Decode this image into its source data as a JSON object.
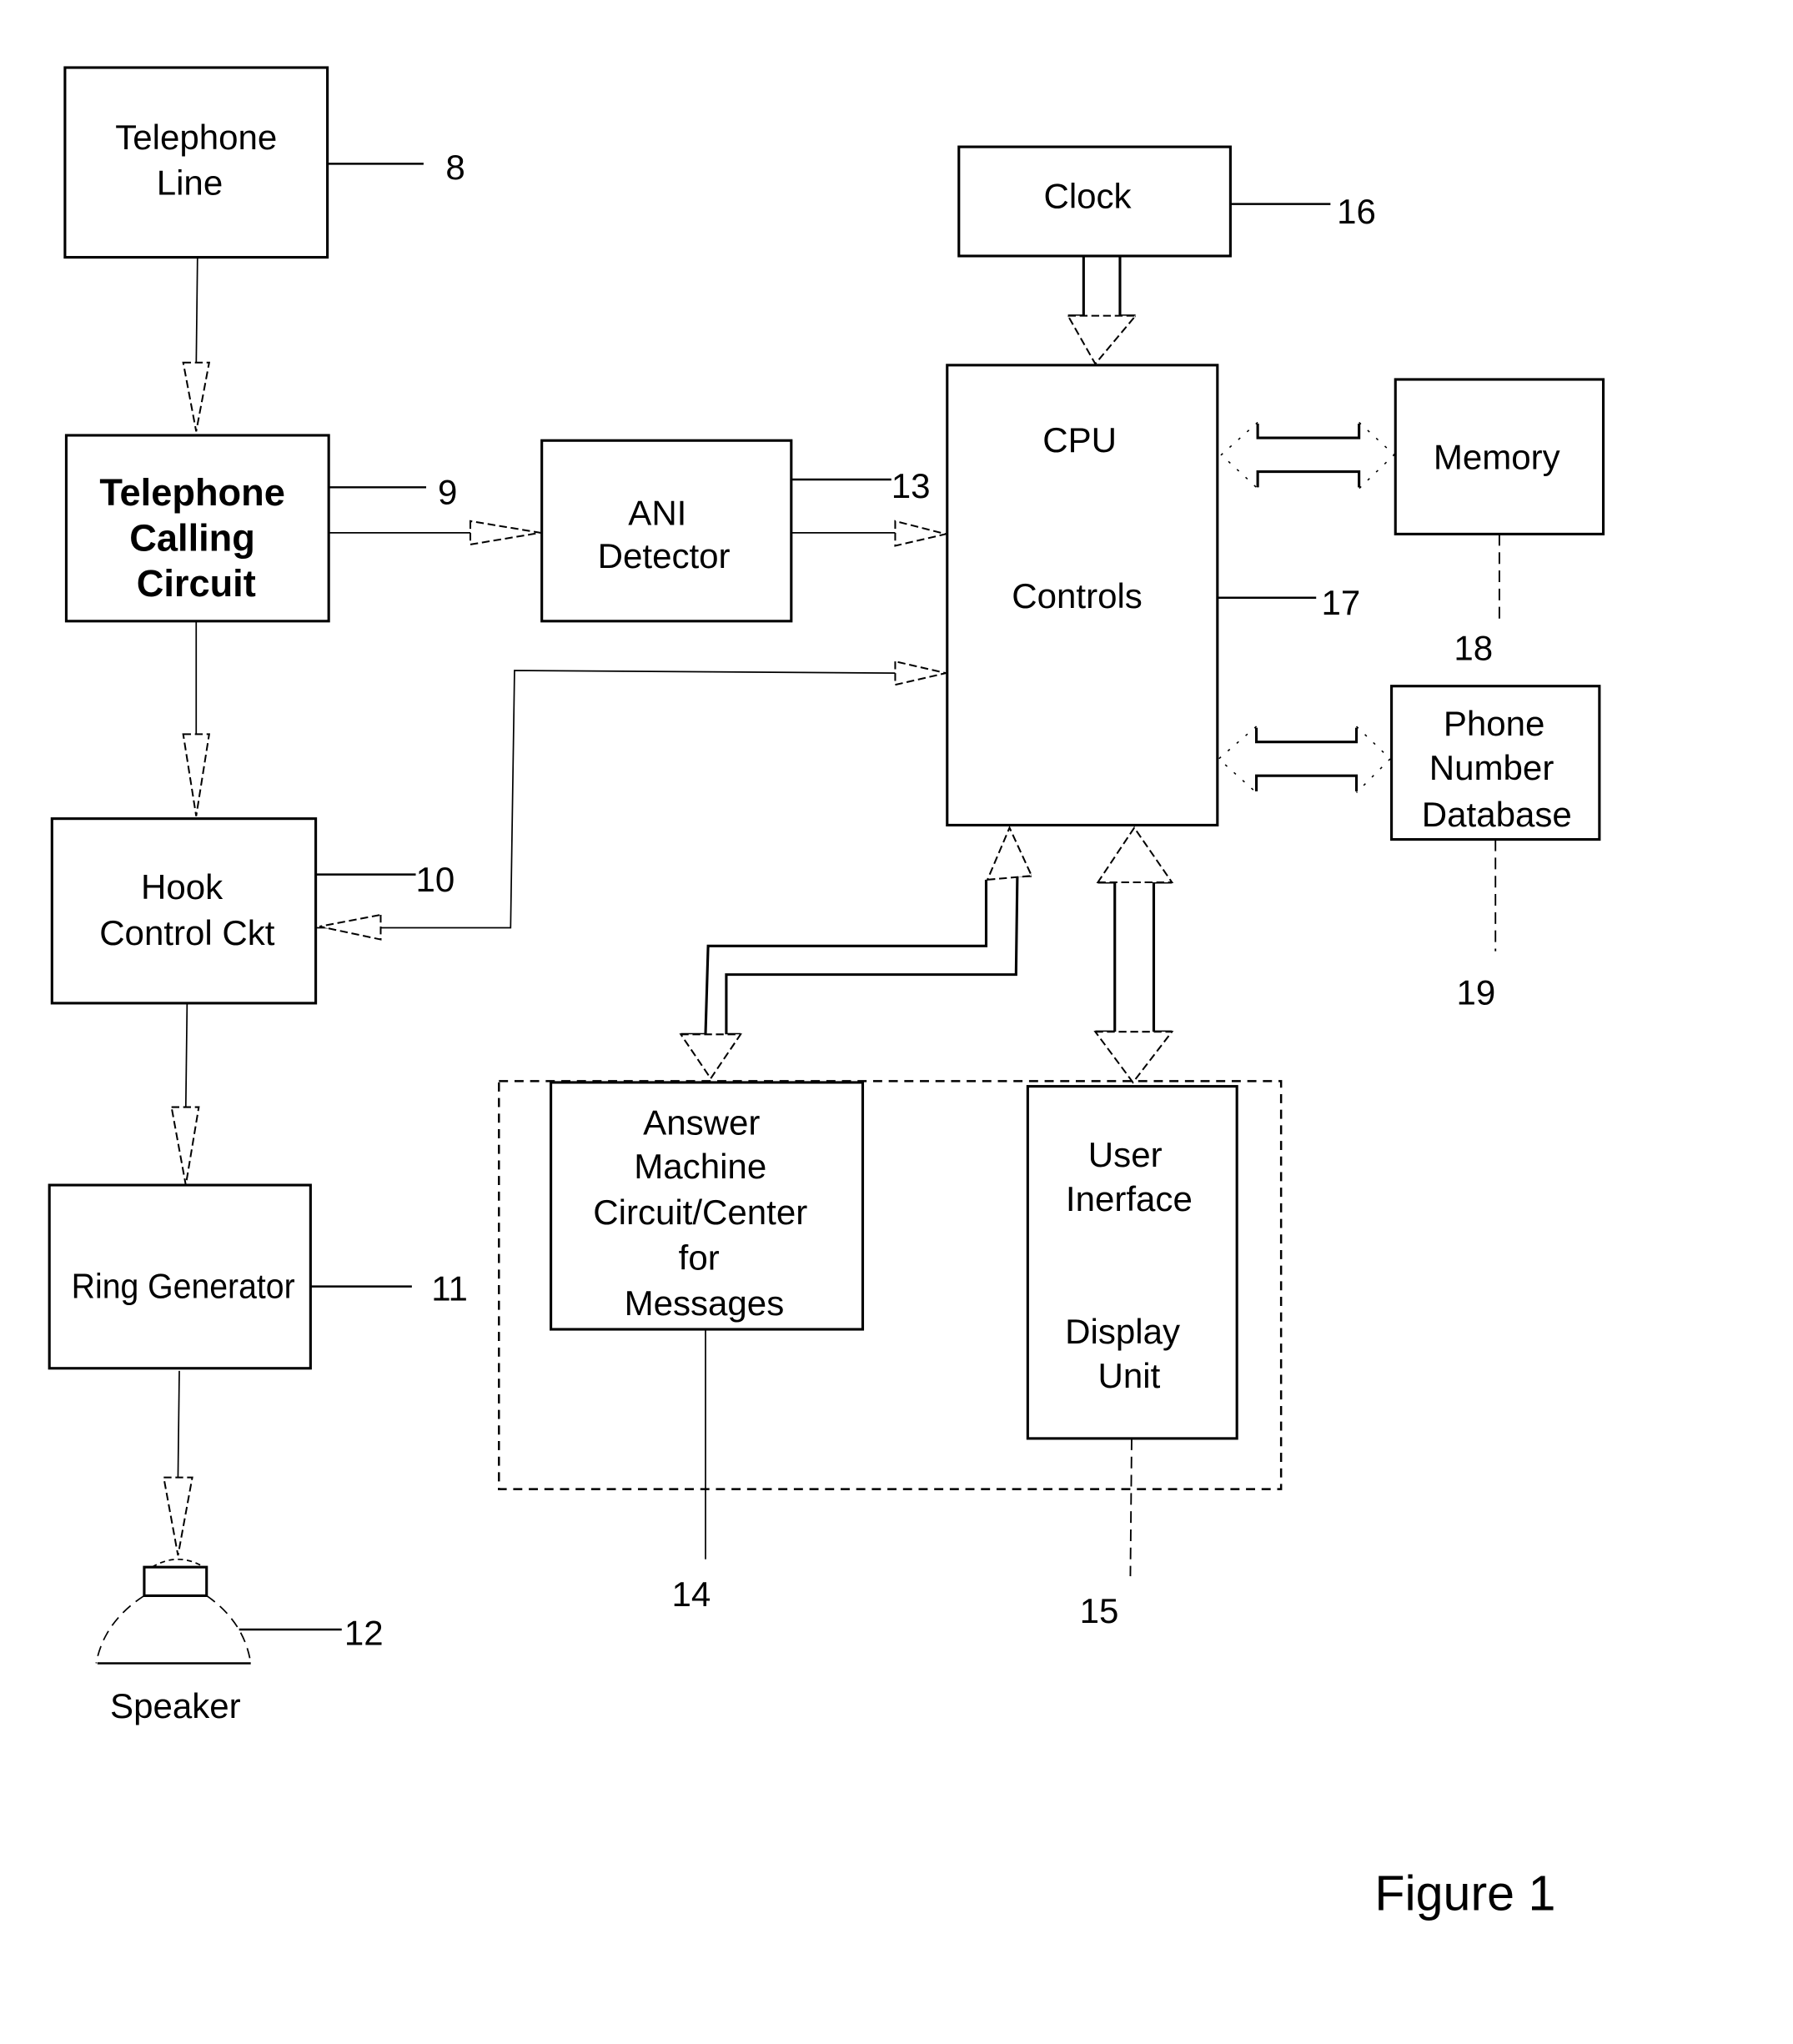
{
  "figure": {
    "caption": "Figure 1",
    "ink_color": "#000000",
    "paper_color": "#ffffff"
  },
  "blocks": {
    "telephone_line": {
      "lines": [
        "Telephone",
        "Line"
      ],
      "ref": "8"
    },
    "calling_circuit": {
      "lines": [
        "Telephone",
        "Calling",
        "Circuit"
      ],
      "ref": "9"
    },
    "hook_control": {
      "lines": [
        "Hook",
        "Control Ckt"
      ],
      "ref": "10"
    },
    "ring_generator": {
      "lines": [
        "Ring Generator"
      ],
      "ref": "11"
    },
    "speaker": {
      "lines": [
        "Speaker"
      ],
      "ref": "12"
    },
    "ani_detector": {
      "lines": [
        "ANI",
        "Detector"
      ],
      "ref": "13"
    },
    "answer_machine": {
      "lines": [
        "Answer",
        "Machine",
        "Circuit/Center",
        "for",
        "Messages"
      ],
      "ref": "14"
    },
    "user_interface": {
      "lines": [
        "User",
        "Inerface",
        "Display",
        "Unit"
      ],
      "ref": "15"
    },
    "clock": {
      "lines": [
        "Clock"
      ],
      "ref": "16"
    },
    "cpu": {
      "lines": [
        "CPU",
        "Controls"
      ],
      "ref": "17"
    },
    "memory": {
      "lines": [
        "Memory"
      ],
      "ref": "18"
    },
    "phone_db": {
      "lines": [
        "Phone",
        "Number",
        "Database"
      ],
      "ref": "19"
    }
  },
  "connections": [
    {
      "from": "Telephone Line",
      "to": "Telephone Calling Circuit",
      "type": "arrow"
    },
    {
      "from": "Telephone Calling Circuit",
      "to": "ANI Detector",
      "type": "arrow"
    },
    {
      "from": "Telephone Calling Circuit",
      "to": "Hook Control Ckt",
      "type": "arrow"
    },
    {
      "from": "ANI Detector",
      "to": "CPU Controls",
      "type": "arrow"
    },
    {
      "from": "Hook Control Ckt",
      "to": "CPU Controls",
      "type": "arrow"
    },
    {
      "from": "CPU Controls",
      "to": "Hook Control Ckt",
      "type": "arrow"
    },
    {
      "from": "Hook Control Ckt",
      "to": "Ring Generator",
      "type": "arrow"
    },
    {
      "from": "Ring Generator",
      "to": "Speaker",
      "type": "arrow"
    },
    {
      "from": "Clock",
      "to": "CPU Controls",
      "type": "bus-arrow"
    },
    {
      "from": "CPU Controls",
      "to": "Memory",
      "type": "bidirectional-bus"
    },
    {
      "from": "CPU Controls",
      "to": "Phone Number Database",
      "type": "bidirectional-bus"
    },
    {
      "from": "CPU Controls",
      "to": "Answer Machine Circuit/Center for Messages",
      "type": "bidirectional-bus"
    },
    {
      "from": "CPU Controls",
      "to": "User Inerface / Display Unit",
      "type": "bidirectional-bus"
    }
  ]
}
